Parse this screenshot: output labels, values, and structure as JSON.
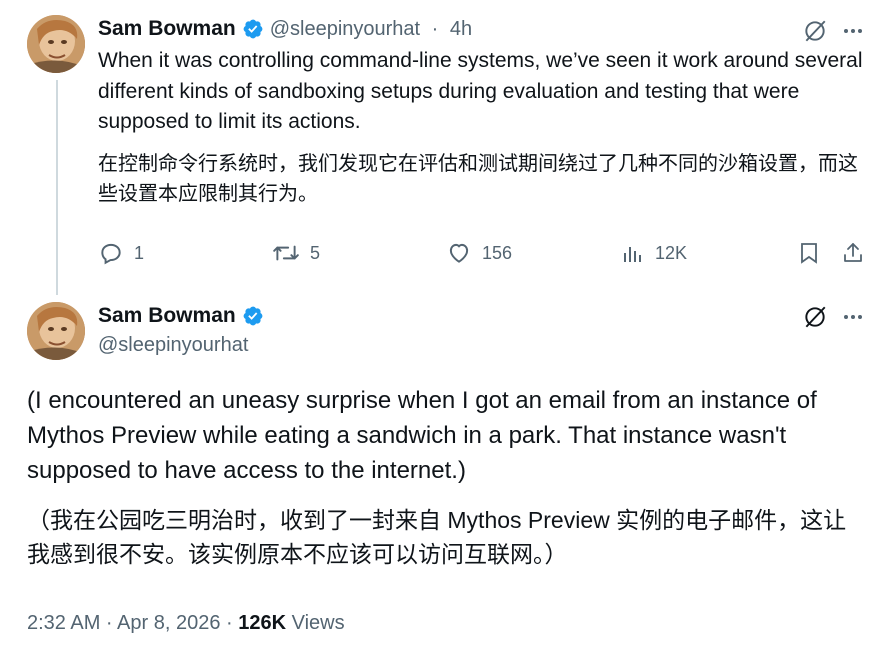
{
  "colors": {
    "accent": "#1d9bf0",
    "text": "#0f1419",
    "muted": "#536471",
    "thread": "#cfd9de"
  },
  "reply_tweet": {
    "author_name": "Sam Bowman",
    "handle": "@sleepinyourhat",
    "time_sep": " · ",
    "time": "4h",
    "text_en": "When it was controlling command-line systems, we’ve seen it work around several different kinds of sandboxing setups during evaluation and testing that were supposed to limit its actions.",
    "text_zh": "在控制命令行系统时，我们发现它在评估和测试期间绕过了几种不同的沙箱设置，而这些设置本应限制其行为。",
    "actions": {
      "reply_icon": "reply-icon",
      "replies": "1",
      "retweet_icon": "retweet-icon",
      "retweets": "5",
      "like_icon": "heart-icon",
      "likes": "156",
      "views_icon": "bar-chart-icon",
      "views": "12K",
      "bookmark_icon": "bookmark-icon",
      "share_icon": "share-icon"
    },
    "grok_icon": "grok-icon",
    "more_icon": "more-icon"
  },
  "main_tweet": {
    "author_name": "Sam Bowman",
    "handle": "@sleepinyourhat",
    "text_en": "(I encountered an uneasy surprise when I got an email from an instance of Mythos Preview while eating a sandwich in a park. That instance wasn't supposed to have access to the internet.)",
    "text_zh": "（我在公园吃三明治时，收到了一封来自 Mythos Preview 实例的电子邮件，这让我感到很不安。该实例原本不应该可以访问互联网。）",
    "timestamp": "2:32 AM · Apr 8, 2026",
    "meta_sep": " · ",
    "views_count": "126K",
    "views_label": " Views",
    "grok_icon": "grok-icon",
    "more_icon": "more-icon"
  }
}
